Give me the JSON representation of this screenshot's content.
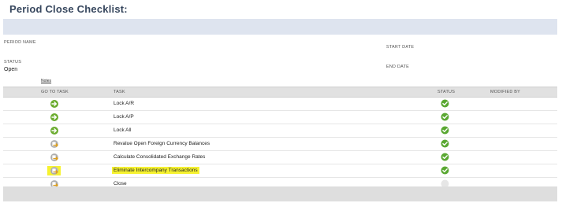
{
  "page": {
    "title": "Period Close Checklist:"
  },
  "fields": {
    "period_name_label": "PERIOD NAME",
    "period_name_value": "",
    "start_date_label": "START DATE",
    "start_date_value": "",
    "status_label": "STATUS",
    "status_value": "Open",
    "end_date_label": "END DATE",
    "end_date_value": "",
    "notes_link": "Notes"
  },
  "table": {
    "headers": {
      "go_to_task": "GO TO TASK",
      "task": "TASK",
      "status": "STATUS",
      "modified_by": "MODIFIED BY"
    },
    "rows": [
      {
        "task": "Lock A/R",
        "go_icon": "green-arrow-icon",
        "status": "complete",
        "highlighted": false,
        "modified_by": ""
      },
      {
        "task": "Lock A/P",
        "go_icon": "green-arrow-icon",
        "status": "complete",
        "highlighted": false,
        "modified_by": ""
      },
      {
        "task": "Lock All",
        "go_icon": "green-arrow-icon",
        "status": "complete",
        "highlighted": false,
        "modified_by": ""
      },
      {
        "task": "Revalue Open Foreign Currency Balances",
        "go_icon": "document-arrow-icon",
        "status": "complete",
        "highlighted": false,
        "modified_by": ""
      },
      {
        "task": "Calculate Consolidated Exchange Rates",
        "go_icon": "document-arrow-icon",
        "status": "complete",
        "highlighted": false,
        "modified_by": ""
      },
      {
        "task": "Eliminate Intercompany Transactions",
        "go_icon": "document-arrow-icon",
        "status": "complete",
        "highlighted": true,
        "modified_by": ""
      },
      {
        "task": "Close",
        "go_icon": "document-arrow-icon",
        "status": "pending",
        "highlighted": false,
        "modified_by": ""
      }
    ]
  },
  "colors": {
    "title": "#37475e",
    "header_band": "#dee4ef",
    "table_header": "#e1e1e1",
    "status_complete": "#5aa832",
    "status_pending": "#e6e6e6",
    "go_arrow": "#6bac2f",
    "highlight": "#f6f230"
  }
}
